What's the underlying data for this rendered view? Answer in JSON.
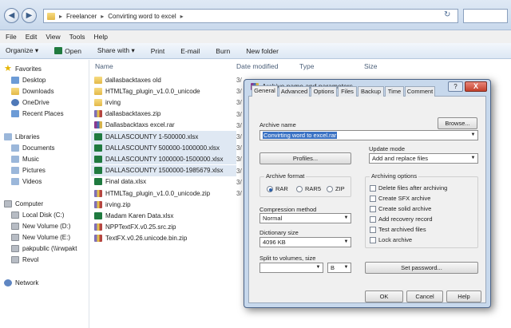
{
  "window": {
    "breadcrumb": [
      "Freelancer",
      "Convirting word to excel"
    ],
    "back_glyph": "◀",
    "forward_glyph": "▶",
    "refresh_glyph": "↻",
    "breadcrumb_sep": "▸"
  },
  "menu": [
    "File",
    "Edit",
    "View",
    "Tools",
    "Help"
  ],
  "toolbar": {
    "organize": "Organize ▾",
    "open": "Open",
    "share": "Share with ▾",
    "print": "Print",
    "email": "E-mail",
    "burn": "Burn",
    "new_folder": "New folder"
  },
  "nav": {
    "favorites": "Favorites",
    "fav_items": [
      "Desktop",
      "Downloads",
      "OneDrive",
      "Recent Places"
    ],
    "libraries": "Libraries",
    "lib_items": [
      "Documents",
      "Music",
      "Pictures",
      "Videos"
    ],
    "computer": "Computer",
    "comp_items": [
      "Local Disk (C:)",
      "New Volume (D:)",
      "New Volume (E:)",
      "pakpublic (\\\\irwpakt",
      "Revol"
    ],
    "network": "Network"
  },
  "columns": {
    "name": "Name",
    "date": "Date modified",
    "type": "Type",
    "size": "Size"
  },
  "files": [
    {
      "name": "dallasbacktaxes old",
      "icon": "folder",
      "selected": false
    },
    {
      "name": "HTMLTag_plugin_v1.0.0_unicode",
      "icon": "folder",
      "selected": false
    },
    {
      "name": "irving",
      "icon": "folder",
      "selected": false
    },
    {
      "name": "dallasbacktaxes.zip",
      "icon": "zip",
      "selected": false
    },
    {
      "name": "Dallasbacktaxs excel.rar",
      "icon": "rar",
      "selected": false
    },
    {
      "name": "DALLASCOUNTY 1-500000.xlsx",
      "icon": "excel",
      "selected": true
    },
    {
      "name": "DALLASCOUNTY 500000-1000000.xlsx",
      "icon": "excel",
      "selected": true
    },
    {
      "name": "DALLASCOUNTY 1000000-1500000.xlsx",
      "icon": "excel",
      "selected": true
    },
    {
      "name": "DALLASCOUNTY 1500000-1985679.xlsx",
      "icon": "excel",
      "selected": true
    },
    {
      "name": "Final data.xlsx",
      "icon": "excel",
      "selected": false
    },
    {
      "name": "HTMLTag_plugin_v1.0.0_unicode.zip",
      "icon": "zip",
      "selected": false
    },
    {
      "name": "irving.zip",
      "icon": "zip",
      "selected": false
    },
    {
      "name": "Madam Karen Data.xlsx",
      "icon": "excel",
      "selected": false
    },
    {
      "name": "NPPTextFX.v0.25.src.zip",
      "icon": "zip",
      "selected": false
    },
    {
      "name": "TextFX.v0.26.unicode.bin.zip",
      "icon": "zip",
      "selected": false
    }
  ],
  "date_fragment": "3/",
  "dialog": {
    "title": "Archive name and parameters",
    "help": "?",
    "close": "X",
    "tabs": [
      "General",
      "Advanced",
      "Options",
      "Files",
      "Backup",
      "Time",
      "Comment"
    ],
    "archive_name_label": "Archive name",
    "browse": "Browse...",
    "archive_name_value": "Convirting word to excel.rar",
    "update_mode_label": "Update mode",
    "update_mode_value": "Add and replace files",
    "profiles": "Profiles...",
    "archive_format_label": "Archive format",
    "formats": [
      "RAR",
      "RAR5",
      "ZIP"
    ],
    "selected_format": "RAR",
    "archiving_options_label": "Archiving options",
    "options": [
      "Delete files after archiving",
      "Create SFX archive",
      "Create solid archive",
      "Add recovery record",
      "Test archived files",
      "Lock archive"
    ],
    "compression_label": "Compression method",
    "compression_value": "Normal",
    "dict_label": "Dictionary size",
    "dict_value": "4096 KB",
    "split_label": "Split to volumes, size",
    "split_value": "",
    "split_unit": "B",
    "set_password": "Set password...",
    "ok": "OK",
    "cancel": "Cancel",
    "help_btn": "Help"
  }
}
